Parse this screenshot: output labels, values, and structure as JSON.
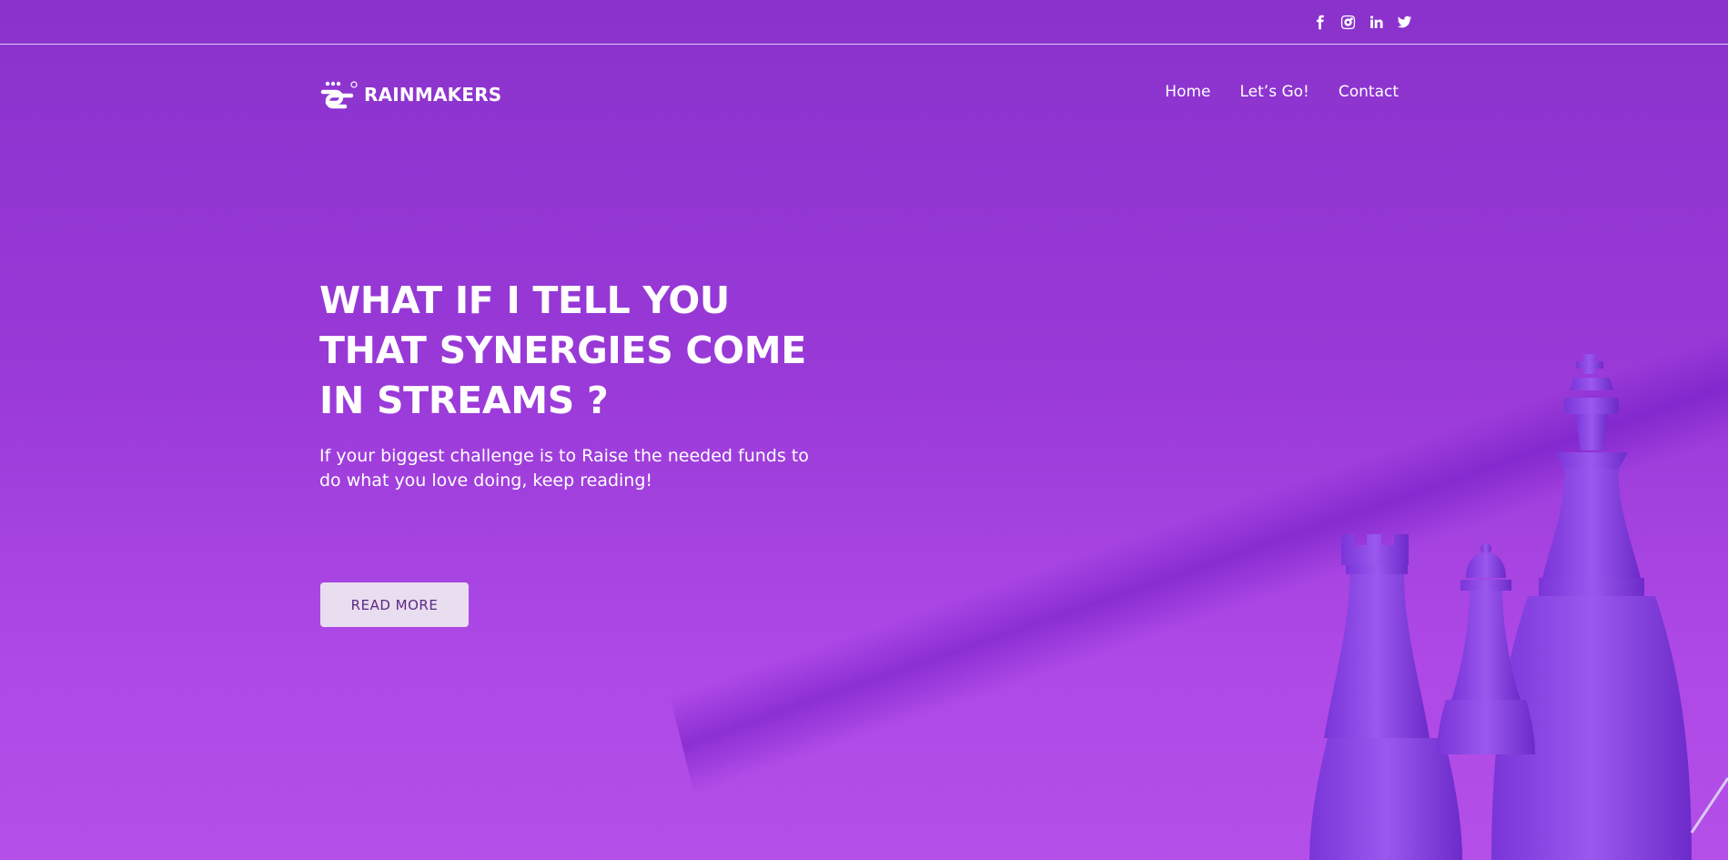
{
  "social": [
    {
      "icon": "facebook-icon"
    },
    {
      "icon": "instagram-icon"
    },
    {
      "icon": "linkedin-icon"
    },
    {
      "icon": "twitter-icon"
    }
  ],
  "brand": {
    "name": "RAINMAKERS",
    "logo_icon": "rainmakers-logo-icon"
  },
  "nav": {
    "items": [
      "Home",
      "Let’s Go!",
      "Contact"
    ]
  },
  "hero": {
    "title": "WHAT IF I TELL YOU THAT SYNERGIES COME IN STREAMS ?",
    "subtitle": "If your biggest challenge is to Raise the needed funds to do what you love doing, keep reading!",
    "cta": "READ MORE"
  },
  "colors": {
    "background": "#9a3ad8",
    "button_bg": "#e9ddf0",
    "button_text": "#5b2a80",
    "chess": "#8a3fe0"
  }
}
